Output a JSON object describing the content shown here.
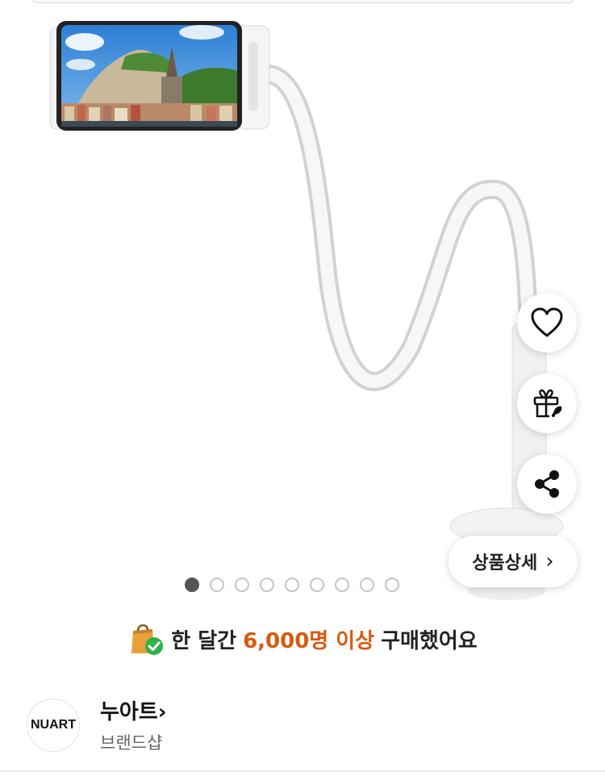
{
  "actions": {
    "like_icon": "heart-icon",
    "gift_icon": "gift-icon",
    "share_icon": "share-icon",
    "detail_label": "상품상세",
    "detail_chevron": "›"
  },
  "gallery": {
    "dot_count": 9,
    "active_index": 0
  },
  "purchase_banner": {
    "prefix": "한 달간",
    "highlight": "6,000명 이상",
    "suffix": "구매했어요",
    "highlight_color": "#d9580f"
  },
  "brand": {
    "logo_text": "NUART",
    "name": "누아트",
    "name_chevron": "›",
    "subtitle": "브랜드샵"
  }
}
